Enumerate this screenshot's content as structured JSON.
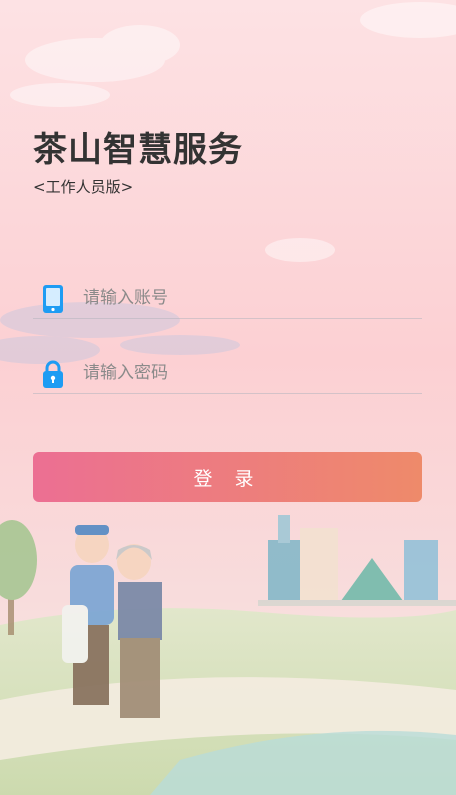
{
  "app": {
    "title": "茶山智慧服务",
    "subtitle": "<工作人员版>"
  },
  "form": {
    "account_placeholder": "请输入账号",
    "account_value": "",
    "password_placeholder": "请输入密码",
    "password_value": ""
  },
  "login_button": {
    "label": "登 录"
  },
  "icons": {
    "account": "phone-icon",
    "password": "lock-icon"
  },
  "colors": {
    "accent_start": "#ec6f93",
    "accent_end": "#ee8a6a",
    "icon_blue": "#1e9cf3"
  }
}
